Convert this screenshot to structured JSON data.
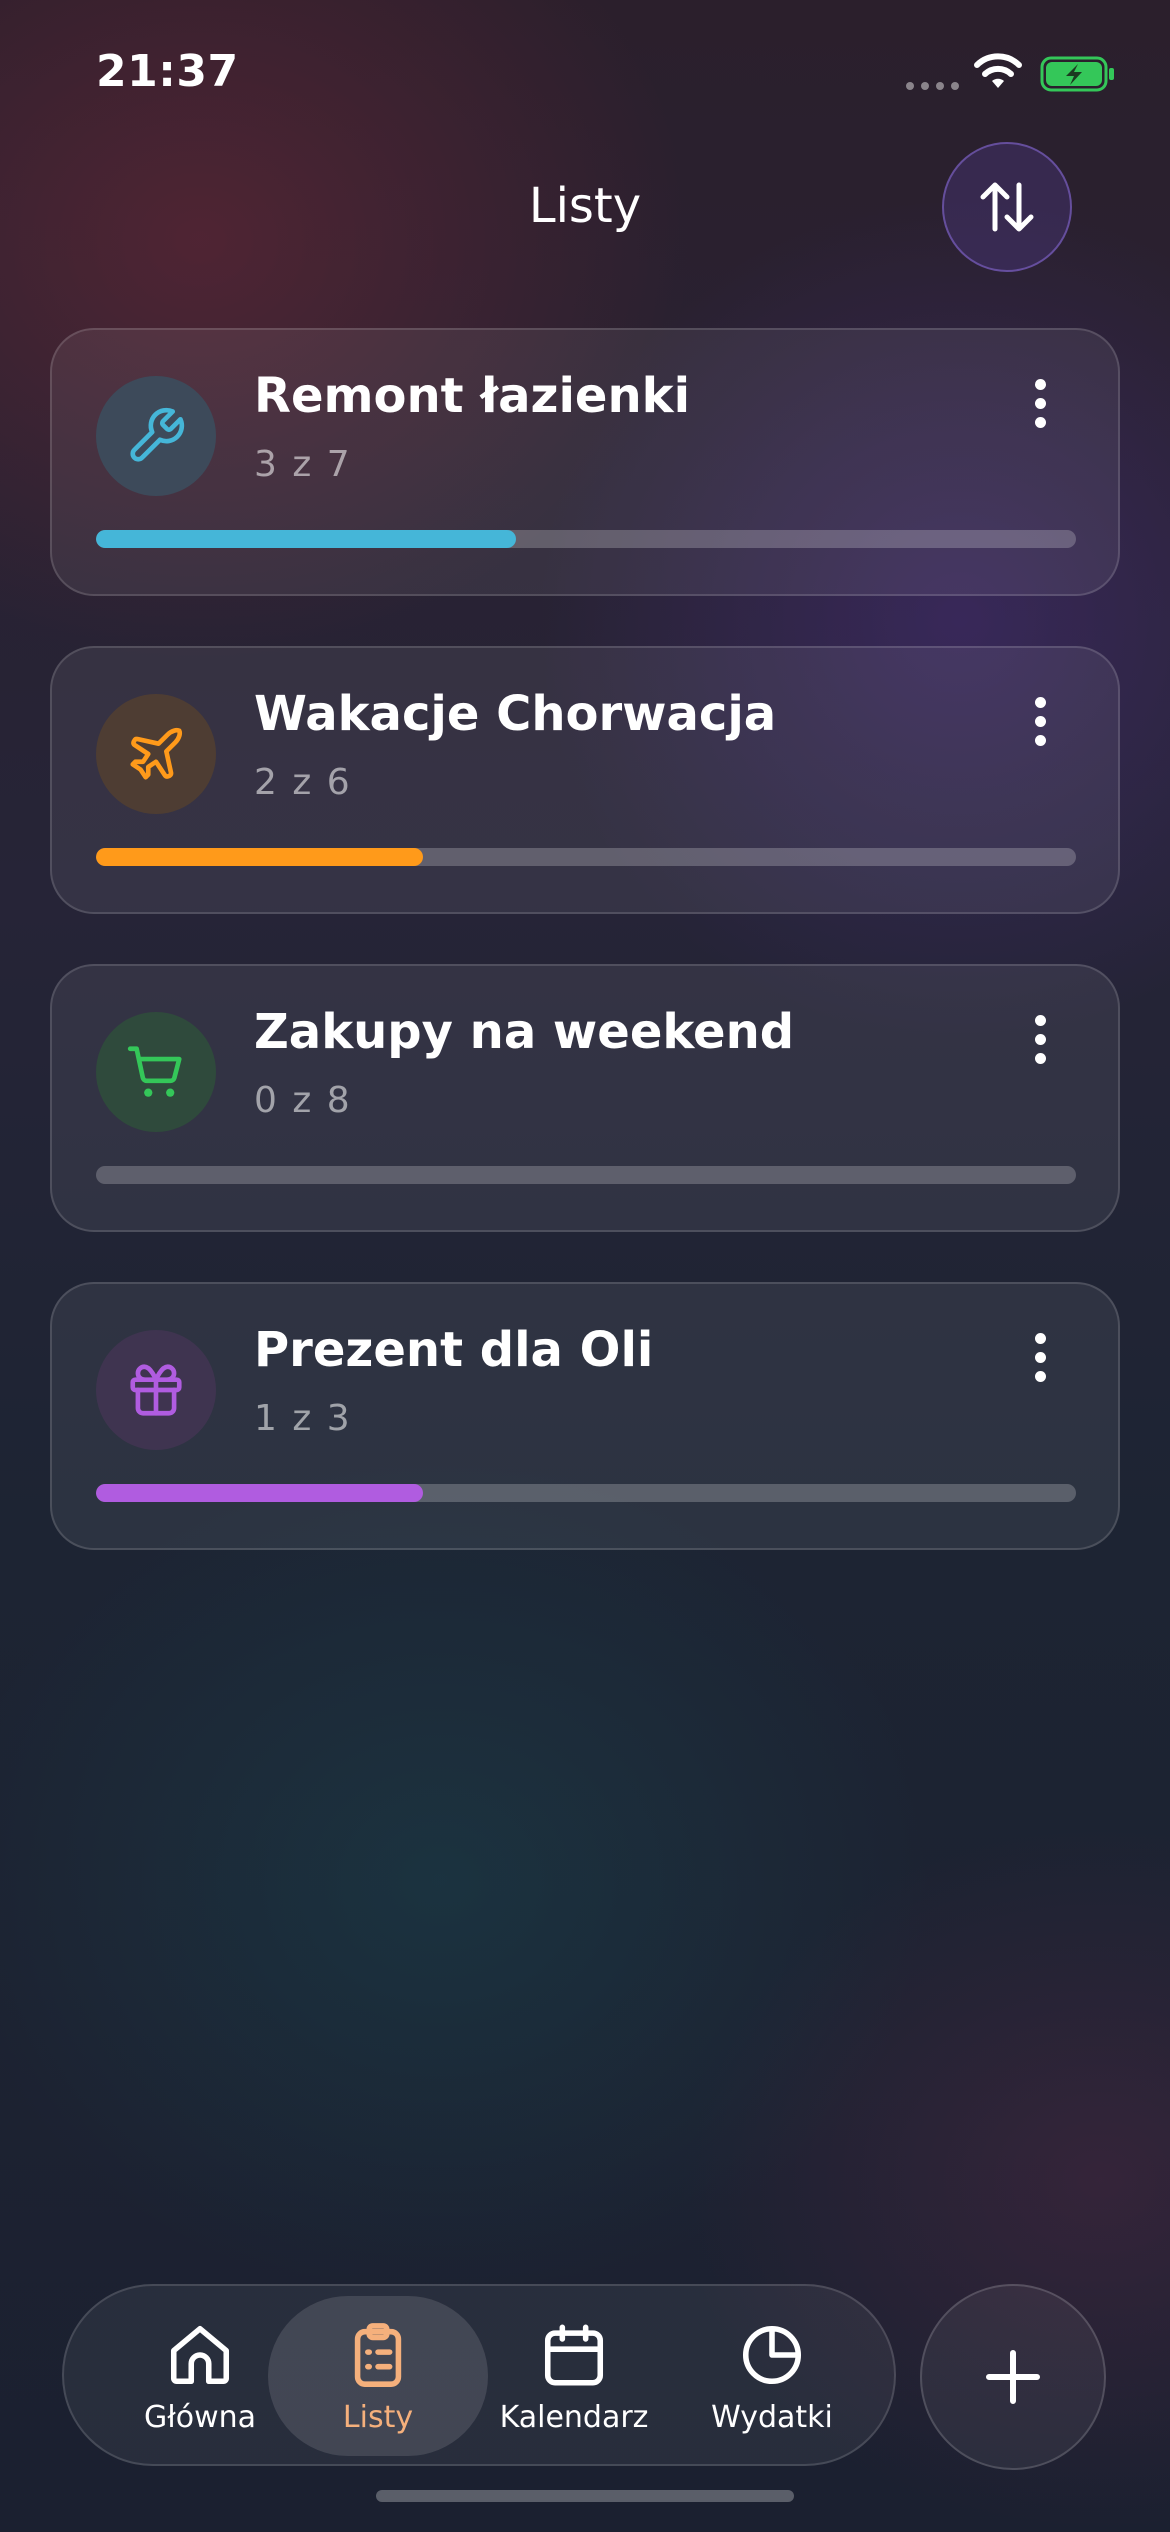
{
  "status_bar": {
    "time": "21:37"
  },
  "header": {
    "title": "Listy",
    "sort_icon": "arrows-up-down-icon"
  },
  "lists": [
    {
      "title": "Remont łazienki",
      "count": "3 z 7",
      "done": 3,
      "total": 7,
      "icon": "wrench-icon",
      "color": "#45b6d8",
      "icon_bg": "#3d4a5a"
    },
    {
      "title": "Wakacje Chorwacja",
      "count": "2 z 6",
      "done": 2,
      "total": 6,
      "icon": "airplane-icon",
      "color": "#ff9a1a",
      "icon_bg": "#4e3d33"
    },
    {
      "title": "Zakupy na weekend",
      "count": "0 z 8",
      "done": 0,
      "total": 8,
      "icon": "cart-icon",
      "color": "#34c759",
      "icon_bg": "#2f4a3c"
    },
    {
      "title": "Prezent dla Oli",
      "count": "1 z 3",
      "done": 1,
      "total": 3,
      "icon": "gift-icon",
      "color": "#b05ce0",
      "icon_bg": "#3f3450"
    }
  ],
  "tab_bar": {
    "tabs": [
      {
        "label": "Główna",
        "icon": "home-icon"
      },
      {
        "label": "Listy",
        "icon": "clipboard-icon",
        "active": true
      },
      {
        "label": "Kalendarz",
        "icon": "calendar-icon"
      },
      {
        "label": "Wydatki",
        "icon": "pie-chart-icon"
      }
    ],
    "active_color": "#f5b07c"
  },
  "add_button": {
    "icon": "plus-icon"
  }
}
